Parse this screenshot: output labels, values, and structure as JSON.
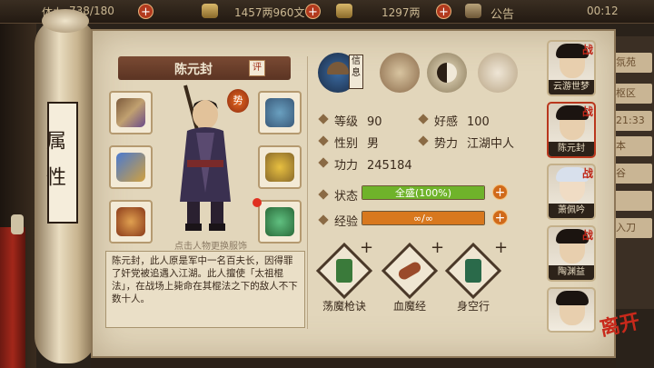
{
  "topbar": {
    "left_label": "体力",
    "left_value": "738/180",
    "money": "1457两960文",
    "gold": "1297两",
    "notice": "公告",
    "time": "00:12"
  },
  "side_tab": {
    "label": "属性"
  },
  "character": {
    "name": "陈元封",
    "review_button": "评",
    "faction_badge": "势",
    "hint": "点击人物更换服饰",
    "description": "陈元封，此人原是军中一名百夫长，因得罪了奸党被追遇入江湖。此人擅使「太祖棍法」，在战场上毙命在其棍法之下的敌人不下数十人。"
  },
  "info_button": "信息",
  "stats": {
    "level_label": "等级",
    "level": "90",
    "favor_label": "好感",
    "favor": "100",
    "gender_label": "性别",
    "gender": "男",
    "faction_label": "势力",
    "faction": "江湖中人",
    "merit_label": "功力",
    "merit": "245184"
  },
  "status": {
    "label": "状态",
    "value": "全盛(100%)",
    "fill": 1.0,
    "color": "#6fb32a"
  },
  "experience": {
    "label": "经验",
    "value": "∞/∞",
    "fill": 1.0,
    "color": "#d8781e"
  },
  "skills": [
    {
      "name": "荡魔枪诀",
      "icon": "spear-manual-icon"
    },
    {
      "name": "血魔经",
      "icon": "scroll-icon"
    },
    {
      "name": "身空行",
      "icon": "movement-manual-icon"
    }
  ],
  "companions": [
    {
      "name": "云游世梦",
      "tag": "战"
    },
    {
      "name": "陈元封",
      "tag": "战"
    },
    {
      "name": "萧佩吟",
      "tag": "战"
    },
    {
      "name": "陶渊益",
      "tag": "战"
    },
    {
      "name": "",
      "tag": ""
    }
  ],
  "close_label": "离开",
  "right_menu": [
    "氛苑",
    "枢区",
    "21:33",
    "本",
    "谷",
    "",
    "入刀"
  ]
}
